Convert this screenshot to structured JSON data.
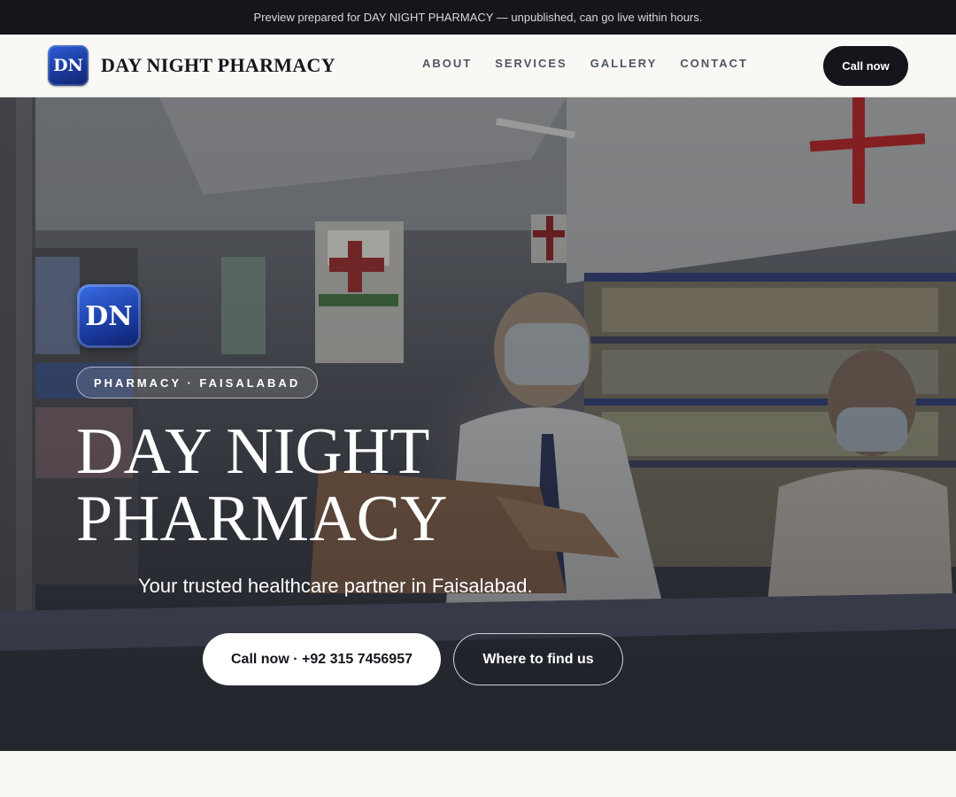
{
  "preview_banner": {
    "text": "Preview prepared for DAY NIGHT PHARMACY — unpublished, can go live within hours."
  },
  "header": {
    "logo_initials": "DN",
    "brand_name": "DAY NIGHT PHARMACY",
    "nav": [
      {
        "label": "ABOUT"
      },
      {
        "label": "SERVICES"
      },
      {
        "label": "GALLERY"
      },
      {
        "label": "CONTACT"
      }
    ],
    "cta_label": "Call now"
  },
  "hero": {
    "logo_initials": "DN",
    "badge": "PHARMACY · FAISALABAD",
    "title_line1": "DAY NIGHT",
    "title_line2": "PHARMACY",
    "subtitle": "Your trusted healthcare partner in Faisalabad.",
    "primary_button": "Call now · +92 315 7456957",
    "secondary_button": "Where to find us",
    "background_image": "pharmacy-interior-photo"
  },
  "colors": {
    "dark": "#14161c",
    "logo_blue": "#1c3fa6",
    "page_bg": "#f7f6f3",
    "white": "#ffffff"
  }
}
